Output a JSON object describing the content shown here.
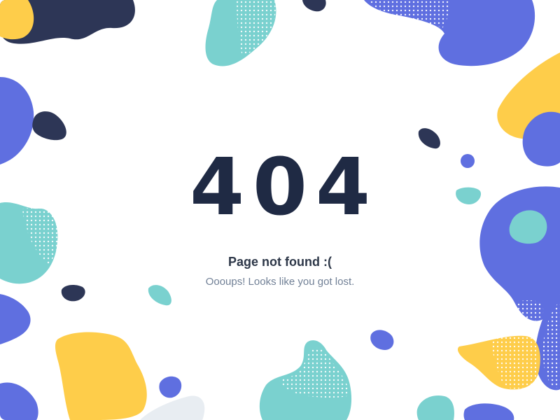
{
  "error_code": "404",
  "title": "Page not found :(",
  "message": "Oooups! Looks like you got lost.",
  "colors": {
    "background": "#ffffff",
    "navy": "#2d3656",
    "indigo": "#5f6fe0",
    "teal": "#7ad1cf",
    "yellow": "#fecd4a",
    "light_gray": "#e8edf2",
    "heading": "#1f2a44",
    "title_text": "#2d3748",
    "subtitle_text": "#718096"
  }
}
